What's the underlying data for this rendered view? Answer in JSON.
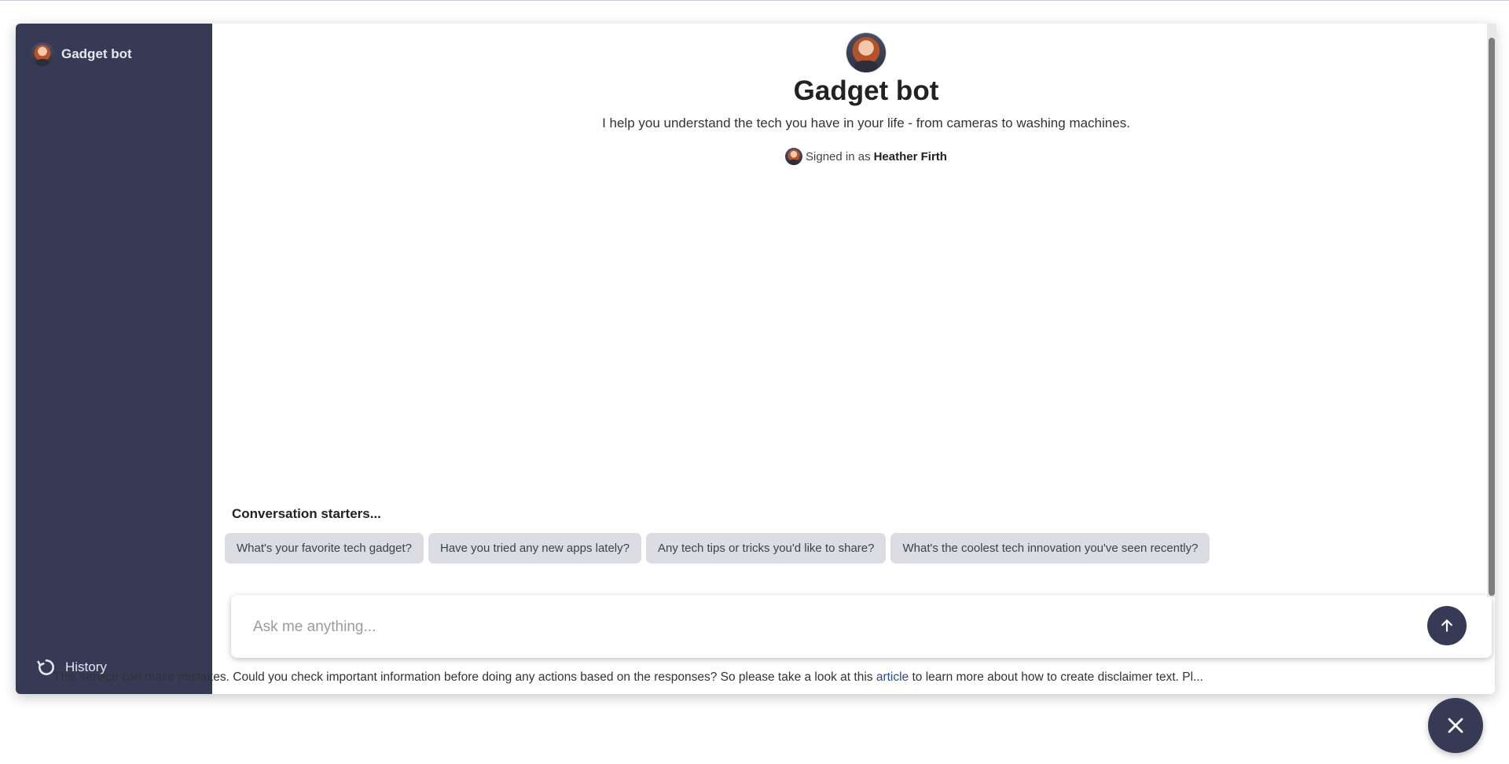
{
  "sidebar": {
    "title": "Gadget bot",
    "history_label": "History"
  },
  "main": {
    "bot_name": "Gadget bot",
    "description": "I help you understand the tech you have in your life - from cameras to washing machines.",
    "signed_in_prefix": "Signed in as",
    "user_name": "Heather Firth"
  },
  "starters": {
    "label": "Conversation starters...",
    "items": [
      "What's your favorite tech gadget?",
      "Have you tried any new apps lately?",
      "Any tech tips or tricks you'd like to share?",
      "What's the coolest tech innovation you've seen recently?"
    ]
  },
  "input": {
    "placeholder": "Ask me anything..."
  },
  "disclaimer": {
    "before_link": "This service can make mistakes. Could you check important information before doing any actions based on the responses? So please take a look at this",
    "link_text": "article",
    "after_link": "to learn more about how to create disclaimer text. Pl..."
  },
  "icons": {
    "history": "history-icon",
    "send": "arrow-up-icon",
    "close": "close-icon"
  },
  "colors": {
    "sidebar": "#363a55",
    "chip": "#dcdde3",
    "accent": "#363a55"
  }
}
